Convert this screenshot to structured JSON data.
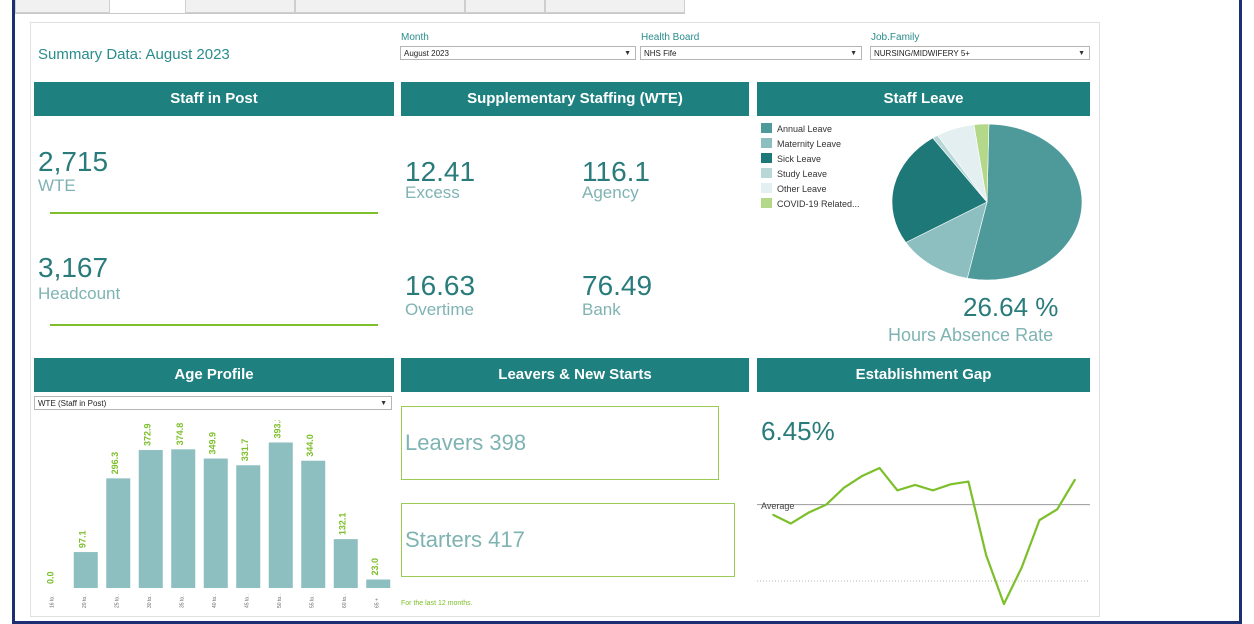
{
  "title": "Summary Data: August 2023",
  "filters": {
    "month": {
      "label": "Month",
      "value": "August 2023"
    },
    "health_board": {
      "label": "Health Board",
      "value": "NHS Fife"
    },
    "job_family": {
      "label": "Job.Family",
      "value": "NURSING/MIDWIFERY 5+"
    }
  },
  "staff_in_post": {
    "header": "Staff in Post",
    "wte_value": "2,715",
    "wte_label": "WTE",
    "headcount_value": "3,167",
    "headcount_label": "Headcount"
  },
  "supplementary": {
    "header": "Supplementary Staffing (WTE)",
    "items": [
      {
        "value": "12.41",
        "label": "Excess"
      },
      {
        "value": "116.1",
        "label": "Agency"
      },
      {
        "value": "16.63",
        "label": "Overtime"
      },
      {
        "value": "76.49",
        "label": "Bank"
      }
    ]
  },
  "staff_leave": {
    "header": "Staff Leave",
    "legend": [
      {
        "label": "Annual Leave",
        "color": "#4e9a9a",
        "share": 0.53
      },
      {
        "label": "Maternity Leave",
        "color": "#8dbec0",
        "share": 0.13
      },
      {
        "label": "Sick Leave",
        "color": "#1e7878",
        "share": 0.24
      },
      {
        "label": "Study Leave",
        "color": "#b8d8d8",
        "share": 0.01
      },
      {
        "label": "Other Leave",
        "color": "#e3eff0",
        "share": 0.065
      },
      {
        "label": "COVID-19 Related...",
        "color": "#b4d88a",
        "share": 0.025
      }
    ],
    "rate_value": "26.64 %",
    "rate_label": "Hours Absence Rate"
  },
  "age_profile": {
    "header": "Age Profile",
    "dropdown": "WTE (Staff in Post)"
  },
  "leavers": {
    "header": "Leavers & New Starts",
    "leavers_text": "Leavers 398",
    "starters_text": "Starters 417",
    "footnote": "For the last 12 months."
  },
  "establishment": {
    "header": "Establishment Gap",
    "value": "6.45%",
    "average_label": "Average"
  },
  "chart_data": [
    {
      "type": "bar",
      "categories": [
        "16 to..",
        "20 to..",
        "25 to..",
        "30 to..",
        "35 to..",
        "40 to..",
        "45 to..",
        "50 to..",
        "55 to..",
        "60 to..",
        "65 +"
      ],
      "values": [
        0.0,
        97.1,
        296.3,
        372.9,
        374.8,
        349.9,
        331.7,
        393.3,
        344.0,
        132.1,
        23.0
      ],
      "labels": [
        "0.0",
        "97.1",
        "296.3",
        "372.9",
        "374.8",
        "349.9",
        "331.7",
        "393.3",
        "344.0",
        "132.1",
        "23.0"
      ],
      "bar_color": "#8dbec0",
      "label_color": "#7cbf2a",
      "ylim": [
        0,
        400
      ]
    },
    {
      "type": "line",
      "x": [
        1,
        2,
        3,
        4,
        5,
        6,
        7,
        8,
        9,
        10,
        11,
        12,
        13,
        14,
        15,
        16,
        17,
        18
      ],
      "values": [
        -1.5,
        -2.8,
        -1.2,
        0,
        2.5,
        4.2,
        5.4,
        2.1,
        2.9,
        2.1,
        3.0,
        3.4,
        -7.5,
        -14.7,
        -9.3,
        -2.3,
        -0.7,
        3.7
      ],
      "average": 0,
      "ylim": [
        -15,
        6
      ],
      "line_color": "#7cbf2a"
    }
  ]
}
